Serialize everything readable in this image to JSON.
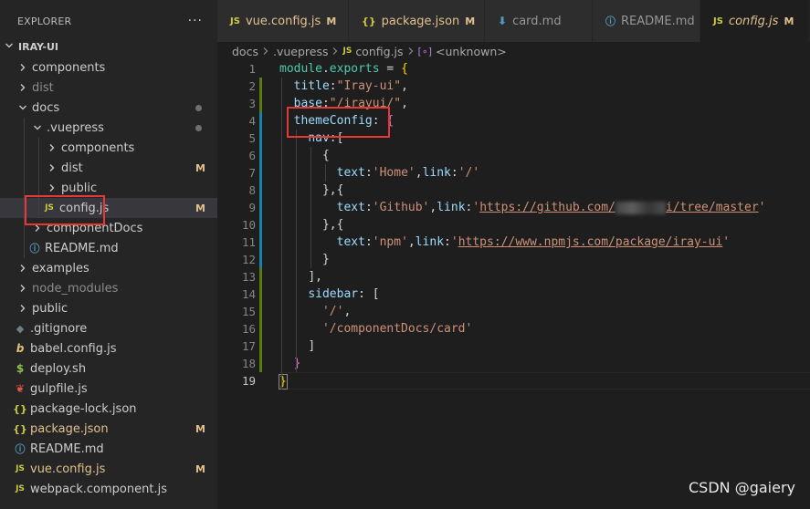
{
  "explorer": {
    "title": "EXPLORER",
    "more": "···",
    "root": "IRAY-UI",
    "items": [
      {
        "label": "components",
        "type": "folder",
        "expanded": false,
        "depth": 0,
        "status": "",
        "mod": false
      },
      {
        "label": "dist",
        "type": "folder",
        "expanded": false,
        "depth": 0,
        "status": "",
        "mod": false,
        "dim": true
      },
      {
        "label": "docs",
        "type": "folder",
        "expanded": true,
        "depth": 0,
        "status": "dot",
        "mod": false
      },
      {
        "label": ".vuepress",
        "type": "folder",
        "expanded": true,
        "depth": 1,
        "status": "dot",
        "mod": false
      },
      {
        "label": "components",
        "type": "folder",
        "expanded": false,
        "depth": 2,
        "status": "",
        "mod": false
      },
      {
        "label": "dist",
        "type": "folder",
        "expanded": false,
        "depth": 2,
        "status": "M",
        "mod": false
      },
      {
        "label": "public",
        "type": "folder",
        "expanded": false,
        "depth": 2,
        "status": "",
        "mod": false
      },
      {
        "label": "config.js",
        "type": "js",
        "depth": 2,
        "status": "M",
        "mod": false,
        "selected": true
      },
      {
        "label": "componentDocs",
        "type": "folder",
        "expanded": false,
        "depth": 1,
        "status": "",
        "mod": false
      },
      {
        "label": "README.md",
        "type": "info",
        "depth": 1,
        "status": "",
        "mod": false
      },
      {
        "label": "examples",
        "type": "folder",
        "expanded": false,
        "depth": 0,
        "status": "",
        "mod": false
      },
      {
        "label": "node_modules",
        "type": "folder",
        "expanded": false,
        "depth": 0,
        "status": "",
        "mod": false,
        "dim": true
      },
      {
        "label": "public",
        "type": "folder",
        "expanded": false,
        "depth": 0,
        "status": "",
        "mod": false
      },
      {
        "label": ".gitignore",
        "type": "git",
        "depth": 0,
        "status": "",
        "mod": false
      },
      {
        "label": "babel.config.js",
        "type": "babel",
        "depth": 0,
        "status": "",
        "mod": false
      },
      {
        "label": "deploy.sh",
        "type": "dollar",
        "depth": 0,
        "status": "",
        "mod": false
      },
      {
        "label": "gulpfile.js",
        "type": "gulp",
        "depth": 0,
        "status": "",
        "mod": false
      },
      {
        "label": "package-lock.json",
        "type": "json",
        "depth": 0,
        "status": "",
        "mod": false
      },
      {
        "label": "package.json",
        "type": "json",
        "depth": 0,
        "status": "M",
        "mod": true
      },
      {
        "label": "README.md",
        "type": "info",
        "depth": 0,
        "status": "",
        "mod": false
      },
      {
        "label": "vue.config.js",
        "type": "js",
        "depth": 0,
        "status": "M",
        "mod": true
      },
      {
        "label": "webpack.component.js",
        "type": "js",
        "depth": 0,
        "status": "",
        "mod": false
      }
    ]
  },
  "tabs": [
    {
      "label": "vue.config.js",
      "icon": "JS",
      "type": "js",
      "badge": "M",
      "mod": true,
      "active": false
    },
    {
      "label": "package.json",
      "icon": "{}",
      "type": "json",
      "badge": "M",
      "mod": true,
      "active": false
    },
    {
      "label": "card.md",
      "icon": "⬇",
      "type": "md",
      "badge": "",
      "mod": false,
      "active": false
    },
    {
      "label": "README.md",
      "icon": "ⓘ",
      "type": "info",
      "badge": "",
      "mod": false,
      "active": false
    },
    {
      "label": "config.js",
      "icon": "JS",
      "type": "js",
      "badge": "M",
      "mod": true,
      "active": true
    }
  ],
  "breadcrumb": {
    "parts": [
      "docs",
      ".vuepress",
      "config.js",
      "<unknown>"
    ],
    "file_icon": "JS",
    "symbol_icon": "[∘]"
  },
  "editor": {
    "line_numbers": [
      "1",
      "2",
      "3",
      "4",
      "5",
      "6",
      "7",
      "8",
      "9",
      "10",
      "11",
      "12",
      "13",
      "14",
      "15",
      "16",
      "17",
      "18",
      "19"
    ],
    "active_line": 19,
    "code": {
      "l1_kw": "module",
      "l1_dot": ".",
      "l1_prop": "exports",
      "l1_eq": " = ",
      "l1_brace": "{",
      "l2_key": "title",
      "l2_colon": ":",
      "l2_val": "\"Iray-ui\"",
      "l2_comma": ",",
      "l3_key": "base",
      "l3_colon": ":",
      "l3_val": "\"/irayui/\"",
      "l3_comma": ",",
      "l4_key": "themeConfig",
      "l4_colon": ": ",
      "l4_brace": "{",
      "l5_key": "nav",
      "l5_colon": ":",
      "l5_br": "[",
      "l6_br": "{",
      "l7_k1": "text",
      "l7_v1": "'Home'",
      "l7_k2": "link",
      "l7_v2": "'/'",
      "l8_br": "},{",
      "l9_k1": "text",
      "l9_v1": "'Github'",
      "l9_k2": "link",
      "l9_q": "'",
      "l9_url_a": "https://github.com/",
      "l9_url_b": "i/tree/master",
      "l9_q2": "'",
      "l10_br": "},{",
      "l11_k1": "text",
      "l11_v1": "'npm'",
      "l11_k2": "link",
      "l11_q": "'",
      "l11_url": "https://www.npmjs.com/package/iray-ui",
      "l11_q2": "'",
      "l12_br": "}",
      "l13_br": "],",
      "l14_key": "sidebar",
      "l14_colon": ": ",
      "l14_br": "[",
      "l15_val": "'/'",
      "l15_comma": ",",
      "l16_val": "'/componentDocs/card'",
      "l17_br": "]",
      "l18_br": "}",
      "l19_br": "}"
    }
  },
  "watermark": "CSDN @gaiery",
  "colors": {
    "highlight_box": "#e53935",
    "modified": "#e2c08d",
    "selected_row": "#37373d"
  }
}
